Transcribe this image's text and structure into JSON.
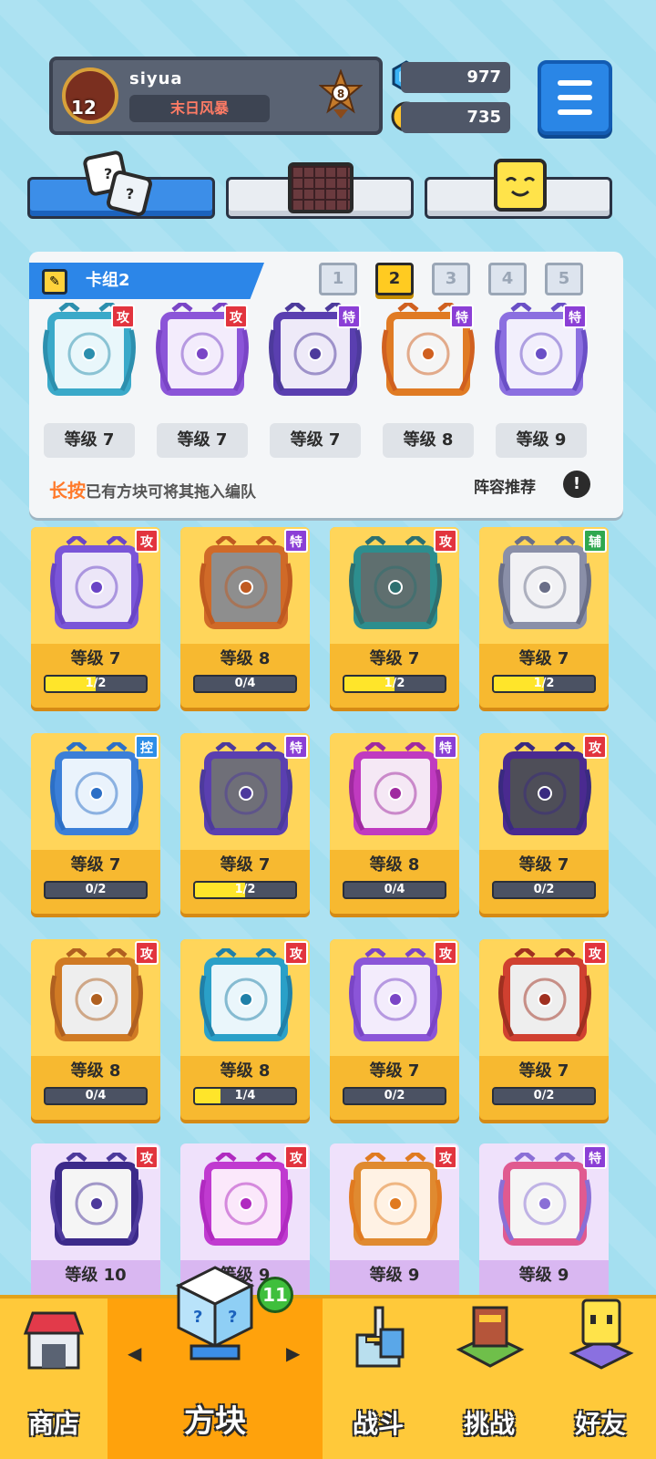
{
  "profile": {
    "username": "siyua",
    "level": "12",
    "title": "末日风暴",
    "rank_number": "8"
  },
  "currency": {
    "gems": "977",
    "coins": "735"
  },
  "deck": {
    "title": "卡组2",
    "numbers": [
      "1",
      "2",
      "3",
      "4",
      "5"
    ],
    "active_number": "2",
    "cards": [
      {
        "badge": "攻",
        "level": "等级 7"
      },
      {
        "badge": "攻",
        "level": "等级 7"
      },
      {
        "badge": "特",
        "level": "等级 7"
      },
      {
        "badge": "特",
        "level": "等级 8"
      },
      {
        "badge": "特",
        "level": "等级 9"
      }
    ],
    "hint_highlight": "长按",
    "hint_text": "已有方块可将其拖入编队",
    "lineup_label": "阵容推荐",
    "lineup_icon": "!"
  },
  "cards": [
    {
      "badge": "攻",
      "level": "等级 7",
      "progress": "1/2",
      "fill": 0.5
    },
    {
      "badge": "特",
      "level": "等级 8",
      "progress": "0/4",
      "fill": 0
    },
    {
      "badge": "攻",
      "level": "等级 7",
      "progress": "1/2",
      "fill": 0.5
    },
    {
      "badge": "辅",
      "level": "等级 7",
      "progress": "1/2",
      "fill": 0.5
    },
    {
      "badge": "控",
      "level": "等级 7",
      "progress": "0/2",
      "fill": 0
    },
    {
      "badge": "特",
      "level": "等级 7",
      "progress": "1/2",
      "fill": 0.5
    },
    {
      "badge": "特",
      "level": "等级 8",
      "progress": "0/4",
      "fill": 0
    },
    {
      "badge": "攻",
      "level": "等级 7",
      "progress": "0/2",
      "fill": 0
    },
    {
      "badge": "攻",
      "level": "等级 8",
      "progress": "0/4",
      "fill": 0
    },
    {
      "badge": "攻",
      "level": "等级 8",
      "progress": "1/4",
      "fill": 0.25
    },
    {
      "badge": "攻",
      "level": "等级 7",
      "progress": "0/2",
      "fill": 0
    },
    {
      "badge": "攻",
      "level": "等级 7",
      "progress": "0/2",
      "fill": 0
    },
    {
      "badge": "攻",
      "level": "等级 10"
    },
    {
      "badge": "攻",
      "level": "等级 9"
    },
    {
      "badge": "攻",
      "level": "等级 9"
    },
    {
      "badge": "特",
      "level": "等级 9"
    }
  ],
  "colors": {
    "attack": "#e2343e",
    "special": "#8b3fd6",
    "support": "#2fa84f",
    "control": "#2d8ee8"
  },
  "nav": {
    "shop": "商店",
    "blocks": "方块",
    "battle": "战斗",
    "challenge": "挑战",
    "friends": "好友",
    "blocks_badge": "11"
  }
}
